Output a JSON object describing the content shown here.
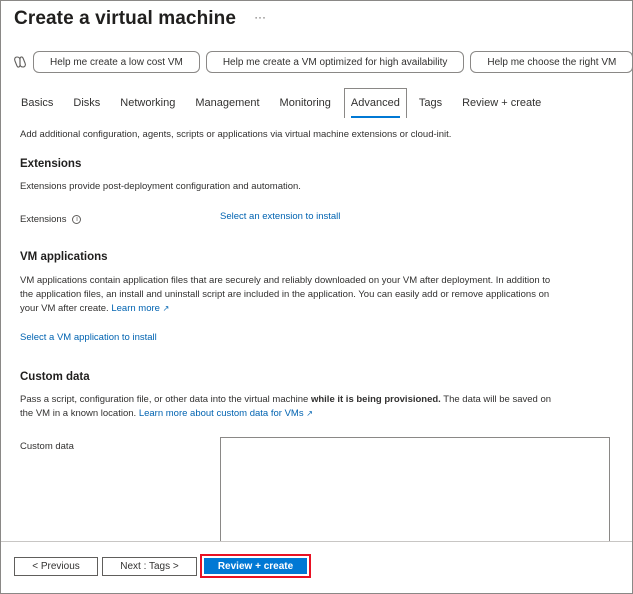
{
  "header": {
    "title": "Create a virtual machine",
    "more": "···"
  },
  "copilot": {
    "prompts": [
      "Help me create a low cost VM",
      "Help me create a VM optimized for high availability",
      "Help me choose the right VM"
    ]
  },
  "tabs": [
    "Basics",
    "Disks",
    "Networking",
    "Management",
    "Monitoring",
    "Advanced",
    "Tags",
    "Review + create"
  ],
  "active_tab": "Advanced",
  "intro": "Add additional configuration, agents, scripts or applications via virtual machine extensions or cloud-init.",
  "extensions": {
    "heading": "Extensions",
    "description": "Extensions provide post-deployment configuration and automation.",
    "label": "Extensions",
    "link": "Select an extension to install"
  },
  "vm_apps": {
    "heading": "VM applications",
    "line1": "VM applications contain application files that are securely and reliably downloaded on your VM after deployment. In addition to",
    "line2": "the application files, an install and uninstall script are included in the application. You can easily add or remove applications on",
    "line3": "your VM after create.",
    "learn_more": "Learn more",
    "link": "Select a VM application to install"
  },
  "custom_data": {
    "heading": "Custom data",
    "line1_a": "Pass a script, configuration file, or other data into the virtual machine ",
    "line1_bold": "while it is being provisioned.",
    "line1_b": " The data will be saved on",
    "line2": "the VM in a known location.",
    "learn_more": "Learn more about custom data for VMs",
    "label": "Custom data",
    "value": ""
  },
  "footer": {
    "previous": "< Previous",
    "next": "Next : Tags >",
    "review": "Review + create"
  }
}
